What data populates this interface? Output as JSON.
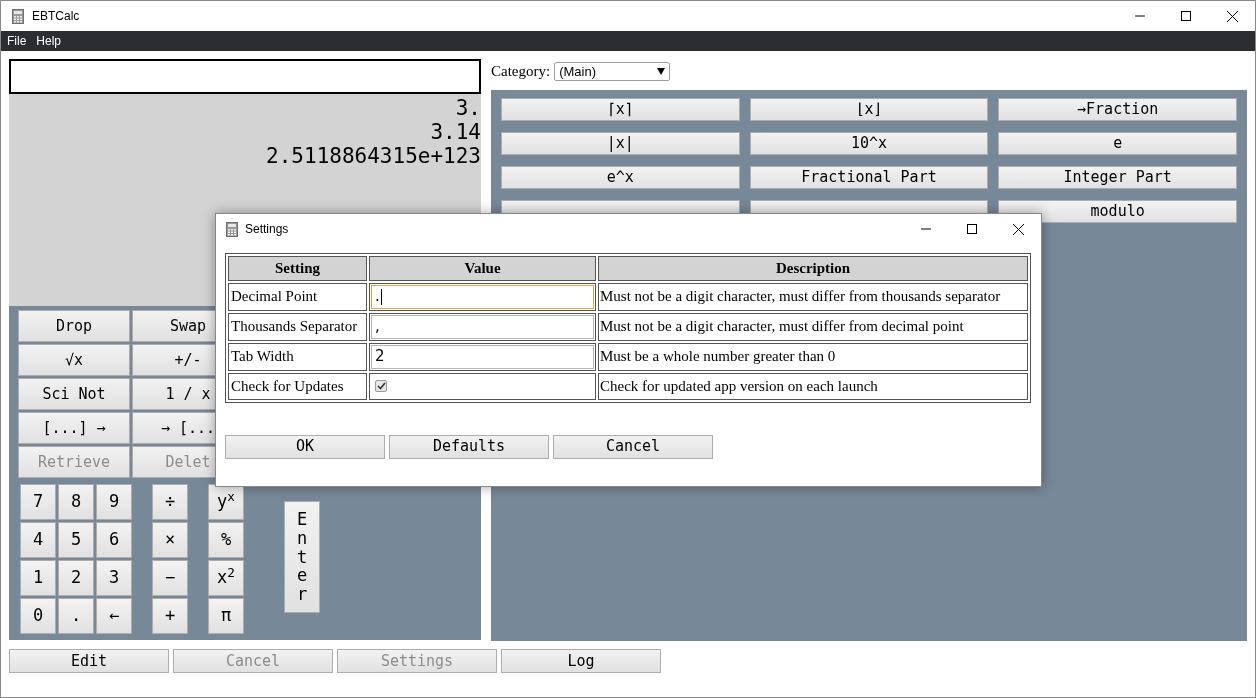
{
  "window": {
    "title": "EBTCalc"
  },
  "menu": [
    "File",
    "Help"
  ],
  "stack": [
    "3.",
    "3.14",
    "2.5118864315e+123"
  ],
  "stack_buttons": [
    {
      "label": "Drop",
      "disabled": false
    },
    {
      "label": "Swap",
      "disabled": false
    },
    {
      "label": "√x",
      "disabled": false
    },
    {
      "label": "+/-",
      "disabled": false
    },
    {
      "label": "Sci Not",
      "disabled": false
    },
    {
      "label": "1 / x",
      "disabled": false
    },
    {
      "label": "[...] →",
      "disabled": false
    },
    {
      "label": "→ [...",
      "disabled": false
    },
    {
      "label": "Retrieve",
      "disabled": true
    },
    {
      "label": "Delet",
      "disabled": true
    }
  ],
  "keypad": {
    "digits": [
      "7",
      "8",
      "9",
      "4",
      "5",
      "6",
      "1",
      "2",
      "3",
      "0",
      ".",
      "←"
    ],
    "operators": [
      "÷",
      "×",
      "−",
      "+"
    ],
    "extras": [
      "y$^{x}$",
      "%",
      "x$^{2}$",
      "π"
    ],
    "enter": "Enter"
  },
  "category": {
    "label": "Category:",
    "value": "(Main)"
  },
  "functions": [
    {
      "kind": "button",
      "label": "⌈x⌉"
    },
    {
      "kind": "button",
      "label": "⌊x⌋"
    },
    {
      "kind": "button",
      "label": "→Fraction"
    },
    {
      "kind": "button",
      "label": "|x|"
    },
    {
      "kind": "button",
      "label": "10^x"
    },
    {
      "kind": "button",
      "label": "e"
    },
    {
      "kind": "button",
      "label": "e^x"
    },
    {
      "kind": "button",
      "label": "Fractional Part"
    },
    {
      "kind": "button",
      "label": "Integer Part"
    },
    {
      "kind": "covered"
    },
    {
      "kind": "covered"
    },
    {
      "kind": "button",
      "label": "modulo"
    }
  ],
  "bottom_buttons": [
    {
      "label": "Edit",
      "disabled": false
    },
    {
      "label": "Cancel",
      "disabled": true
    },
    {
      "label": "Settings",
      "disabled": true
    },
    {
      "label": "Log",
      "disabled": false
    }
  ],
  "dialog": {
    "title": "Settings",
    "columns": [
      "Setting",
      "Value",
      "Description"
    ],
    "rows": [
      {
        "setting": "Decimal Point",
        "kind": "text",
        "value": ".",
        "focused": true,
        "description": "Must not be a digit character, must differ from thousands separator"
      },
      {
        "setting": "Thousands Separator",
        "kind": "text",
        "value": ",",
        "focused": false,
        "description": "Must not be a digit character, must differ from decimal point"
      },
      {
        "setting": "Tab Width",
        "kind": "text",
        "value": "2",
        "focused": false,
        "description": "Must be a whole number greater than 0"
      },
      {
        "setting": "Check for Updates",
        "kind": "checkbox",
        "checked": true,
        "description": "Check for updated app version on each launch"
      }
    ],
    "buttons": [
      "OK",
      "Defaults",
      "Cancel"
    ]
  }
}
